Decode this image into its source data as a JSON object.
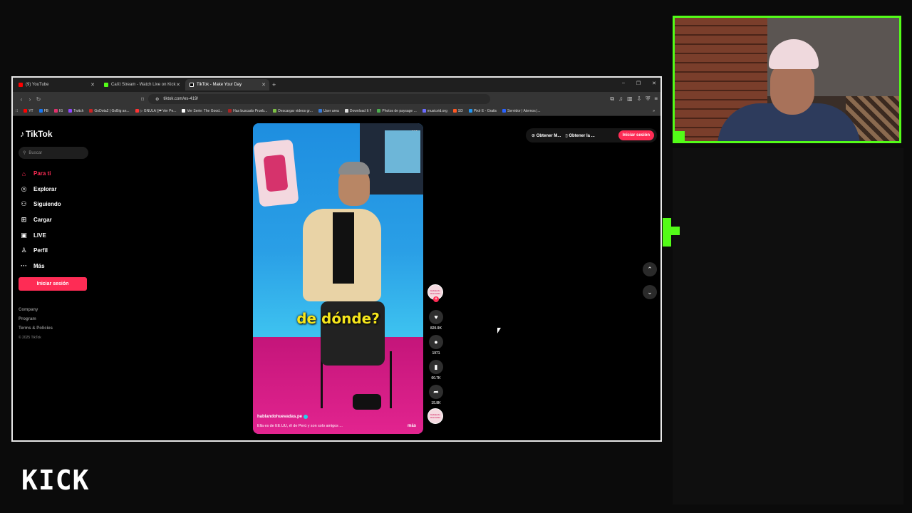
{
  "browser": {
    "tabs": [
      {
        "label": "(9) YouTube",
        "favicon_color": "#ff0000",
        "active": false
      },
      {
        "label": "CaXt Stream - Watch Live on Kick",
        "favicon_color": "#53fc18",
        "active": false
      },
      {
        "label": "TikTok - Make Your Day",
        "favicon_color": "#ffffff",
        "active": true
      }
    ],
    "url": "tiktok.com/es-419/",
    "bookmarks": [
      {
        "label": "YT",
        "color": "#ff0000"
      },
      {
        "label": "FB",
        "color": "#1877f2"
      },
      {
        "label": "IG",
        "color": "#e1306c"
      },
      {
        "label": "Twitch",
        "color": "#9146ff"
      },
      {
        "label": "GoDota2 | GoBig an...",
        "color": "#cc2222"
      },
      {
        "label": "▷ GNULA ||❤ Ver Pe...",
        "color": "#ff3333"
      },
      {
        "label": "Ver Serie: The Good...",
        "color": "#ffffff"
      },
      {
        "label": "Has buscado Prueb...",
        "color": "#aa2222"
      },
      {
        "label": "Descargar videos gr...",
        "color": "#7cc043"
      },
      {
        "label": "User area",
        "color": "#3a7bd5"
      },
      {
        "label": "Download It !!",
        "color": "#dddddd"
      },
      {
        "label": "Photos de paysage ...",
        "color": "#4caf50"
      },
      {
        "label": "musicvid.org",
        "color": "#6b6bff"
      },
      {
        "label": "SD",
        "color": "#ff5722"
      },
      {
        "label": "Pixlr E - Gratis",
        "color": "#2196f3"
      },
      {
        "label": "Servidor | Aternos |...",
        "color": "#2962ff"
      }
    ]
  },
  "tiktok": {
    "logo": "TikTok",
    "search_placeholder": "Buscar",
    "nav": [
      {
        "label": "Para ti",
        "icon": "home-icon",
        "active": true
      },
      {
        "label": "Explorar",
        "icon": "compass-icon",
        "active": false
      },
      {
        "label": "Siguiendo",
        "icon": "following-icon",
        "active": false
      },
      {
        "label": "Cargar",
        "icon": "upload-icon",
        "active": false
      },
      {
        "label": "LIVE",
        "icon": "live-icon",
        "active": false
      },
      {
        "label": "Perfil",
        "icon": "profile-icon",
        "active": false
      },
      {
        "label": "Más",
        "icon": "more-icon",
        "active": false
      }
    ],
    "login_button": "Iniciar sesión",
    "footer": [
      "Company",
      "Program",
      "Terms & Policies"
    ],
    "copyright": "© 2025 TikTok",
    "top_right": {
      "get_app_1": "Obtener M...",
      "get_app_2": "Obtener la ...",
      "login": "Iniciar sesión"
    },
    "video": {
      "caption": "de dónde?",
      "username": "hablandohuevadas.pe",
      "description": "Ella es de EE.UU, él de Perú y son solo amigos ...",
      "more": "más",
      "avatar_text": "Hablando Huevadas"
    },
    "actions": {
      "likes": "820.9K",
      "comments": "1971",
      "saves": "60.7K",
      "shares": "15.8K"
    }
  },
  "stream": {
    "brand": "KICK"
  }
}
